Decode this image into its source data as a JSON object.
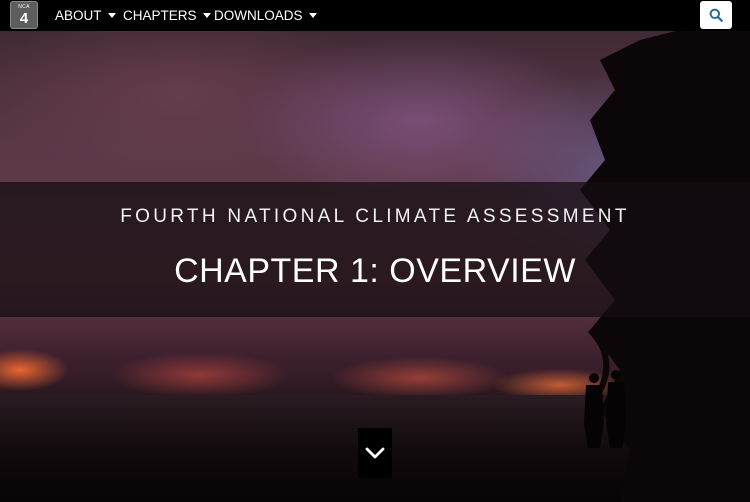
{
  "logo": {
    "small_text": "NCA",
    "number": "4"
  },
  "nav": {
    "items": [
      {
        "label": "ABOUT"
      },
      {
        "label": "CHAPTERS"
      },
      {
        "label": "DOWNLOADS"
      }
    ],
    "search_icon": "search-icon"
  },
  "hero": {
    "supertitle": "FOURTH NATIONAL CLIMATE ASSESSMENT",
    "title": "CHAPTER 1: OVERVIEW",
    "scroll_icon": "chevron-down-icon"
  },
  "colors": {
    "navbar_bg": "#000000",
    "banner_bg": "rgba(20,12,16,0.72)",
    "text": "#ffffff",
    "search_icon": "#2c6b8f"
  }
}
